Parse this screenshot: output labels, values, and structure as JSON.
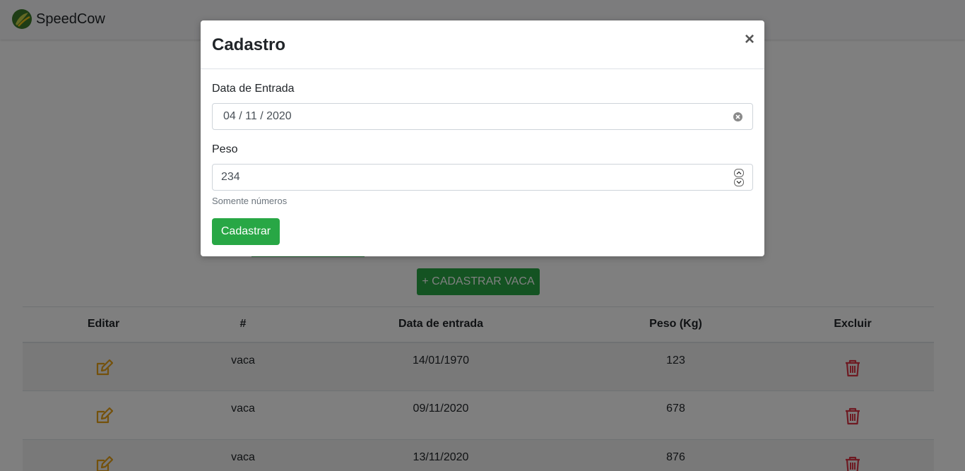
{
  "navbar": {
    "brand": "SpeedCow"
  },
  "page": {
    "add_button": "+ CADASTRAR VACA",
    "table": {
      "headers": [
        "Editar",
        "#",
        "Data de entrada",
        "Peso (Kg)",
        "Excluir"
      ],
      "rows": [
        {
          "name": "vaca",
          "date": "14/01/1970",
          "weight": "123"
        },
        {
          "name": "vaca",
          "date": "09/11/2020",
          "weight": "678"
        },
        {
          "name": "vaca",
          "date": "13/11/2020",
          "weight": "876"
        }
      ]
    }
  },
  "modal": {
    "title": "Cadastro",
    "close": "×",
    "date_label": "Data de Entrada",
    "date_value": "04 / 11 / 2020",
    "weight_label": "Peso",
    "weight_value": "234",
    "weight_hint": "Somente números",
    "submit": "Cadastrar"
  },
  "colors": {
    "accent_green": "#28a745",
    "edit_icon": "#e8a317",
    "delete_icon": "#dc3545"
  }
}
